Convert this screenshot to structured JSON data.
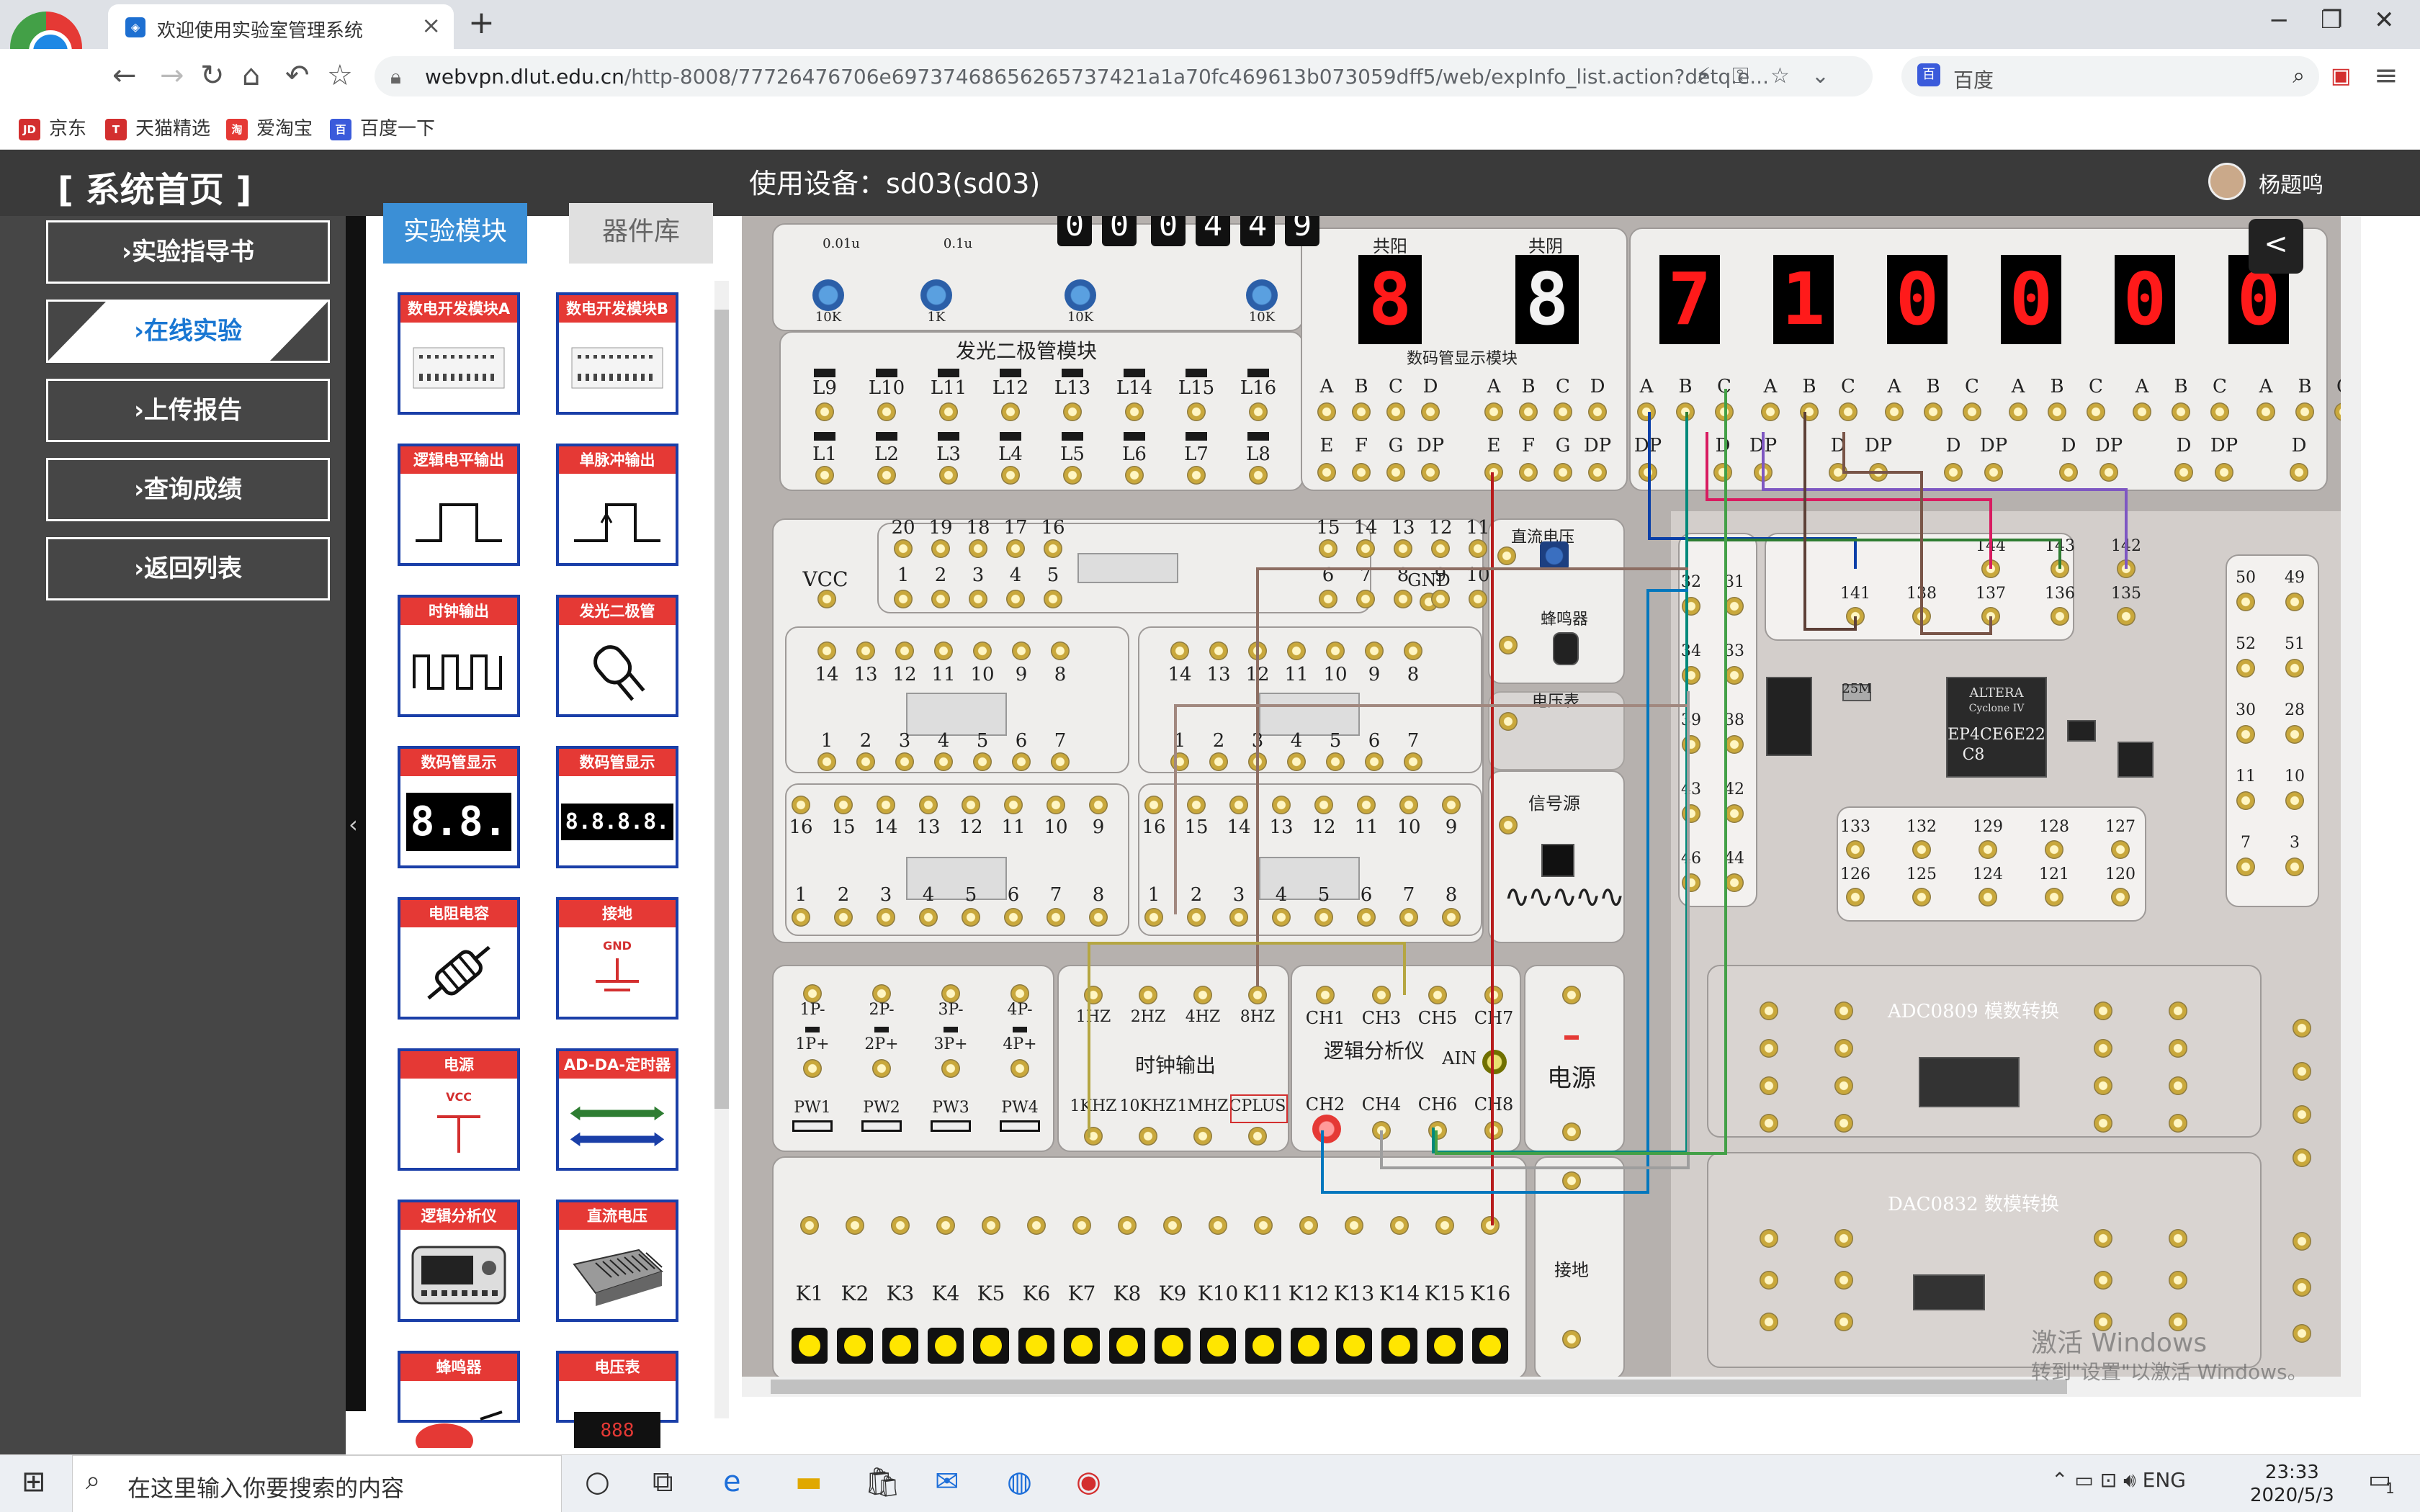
{
  "browser": {
    "tab_title": "欢迎使用实验室管理系统",
    "url_host": "webvpn.dlut.edu.cn",
    "url_path": "/http-8008/77726476706e69737468656265737421a1a70fc469613b073059dff5/web/expInfo_list.action?detq.e...",
    "search_engine": "百度",
    "bookmarks": [
      {
        "label": "京东",
        "icon": "jd-icon",
        "color": "#d32f2f",
        "badge": "JD"
      },
      {
        "label": "天猫精选",
        "icon": "tmall-icon",
        "color": "#d32f2f",
        "badge": "T"
      },
      {
        "label": "爱淘宝",
        "icon": "aitaobao-icon",
        "color": "#e53935",
        "badge": "淘"
      },
      {
        "label": "百度一下",
        "icon": "baidu-icon",
        "color": "#3b5bdb",
        "badge": "百"
      }
    ]
  },
  "header": {
    "home_label": "[ 系统首页 ]",
    "device_label": "使用设备：sd03(sd03)",
    "user_name": "杨题鸣"
  },
  "sidebar": {
    "items": [
      {
        "label": "›实验指导书",
        "active": false
      },
      {
        "label": "›在线实验",
        "active": true
      },
      {
        "label": "›上传报告",
        "active": false
      },
      {
        "label": "›查询成绩",
        "active": false
      },
      {
        "label": "›返回列表",
        "active": false
      }
    ]
  },
  "palette": {
    "tabs": [
      {
        "label": "实验模块",
        "active": true
      },
      {
        "label": "器件库",
        "active": false
      }
    ],
    "modules": [
      {
        "label": "数电开发模块A",
        "icon": "dev-board-icon"
      },
      {
        "label": "数电开发模块B",
        "icon": "dev-board-icon"
      },
      {
        "label": "逻辑电平输出",
        "icon": "logic-level-icon"
      },
      {
        "label": "单脉冲输出",
        "icon": "single-pulse-icon"
      },
      {
        "label": "时钟输出",
        "icon": "clock-wave-icon"
      },
      {
        "label": "发光二极管",
        "icon": "led-icon"
      },
      {
        "label": "数码管显示",
        "icon": "seven-seg-2-icon",
        "glyph": "8.8."
      },
      {
        "label": "数码管显示",
        "icon": "seven-seg-4-icon",
        "glyph": "8.8.8.8."
      },
      {
        "label": "电阻电容",
        "icon": "resistor-icon"
      },
      {
        "label": "接地",
        "icon": "ground-icon",
        "sub": "GND"
      },
      {
        "label": "电源",
        "icon": "power-icon",
        "sub": "VCC"
      },
      {
        "label": "AD-DA-定时器",
        "icon": "ad-da-icon"
      },
      {
        "label": "逻辑分析仪",
        "icon": "logic-analyzer-icon"
      },
      {
        "label": "直流电压",
        "icon": "dc-supply-icon"
      },
      {
        "label": "蜂鸣器",
        "icon": "buzzer-icon"
      },
      {
        "label": "电压表",
        "icon": "voltmeter-icon"
      }
    ]
  },
  "board": {
    "counter_digits": [
      "0",
      "0",
      "0",
      "4",
      "4",
      "9"
    ],
    "pot_labels": [
      "10K",
      "1K",
      "10K",
      "10K"
    ],
    "pot_top_labels": [
      "0.01u",
      "0.1u"
    ],
    "display_module": {
      "title": "数码管显示模块",
      "common_anode_label": "共阳",
      "common_cathode_label": "共阴",
      "single_digits": [
        "8",
        "8"
      ],
      "pins_top": [
        "A",
        "B",
        "C",
        "D",
        "A",
        "B",
        "C",
        "D"
      ],
      "pins_bottom": [
        "E",
        "F",
        "G",
        "DP",
        "E",
        "F",
        "G",
        "DP"
      ]
    },
    "six_digits": [
      "7",
      "1",
      "0",
      "0",
      "0",
      "0"
    ],
    "six_pins_top": [
      "A",
      "B",
      "C",
      "A",
      "B",
      "C",
      "A",
      "B",
      "C",
      "A",
      "B",
      "C",
      "A",
      "B",
      "C",
      "A",
      "B",
      "C"
    ],
    "six_pins_bottom": [
      "DP",
      "D",
      "DP",
      "D",
      "DP",
      "D",
      "DP",
      "D",
      "DP",
      "D",
      "DP",
      "D"
    ],
    "led_module": {
      "title": "发光二极管模块",
      "top_row": [
        "L9",
        "L10",
        "L11",
        "L12",
        "L13",
        "L14",
        "L15",
        "L16"
      ],
      "bottom_row": [
        "L1",
        "L2",
        "L3",
        "L4",
        "L5",
        "L6",
        "L7",
        "L8"
      ]
    },
    "ic_area": {
      "vcc": "VCC",
      "gnd": "GND",
      "dip20_top": [
        "20",
        "19",
        "18",
        "17",
        "16",
        "15",
        "14",
        "13",
        "12",
        "11"
      ],
      "dip20_bottom": [
        "1",
        "2",
        "3",
        "4",
        "5",
        "6",
        "7",
        "8",
        "9",
        "10"
      ],
      "dip14_top": [
        "14",
        "13",
        "12",
        "11",
        "10",
        "9",
        "8"
      ],
      "dip14_bottom": [
        "1",
        "2",
        "3",
        "4",
        "5",
        "6",
        "7"
      ],
      "dip16_top": [
        "16",
        "15",
        "14",
        "13",
        "12",
        "11",
        "10",
        "9"
      ],
      "dip16_bottom": [
        "1",
        "2",
        "3",
        "4",
        "5",
        "6",
        "7",
        "8"
      ]
    },
    "aux_modules": {
      "dc_voltage": "直流电压",
      "buzzer": "蜂鸣器",
      "voltmeter": "电压表",
      "signal_source": "信号源",
      "power": "电源",
      "ground": "接地"
    },
    "pulse": {
      "top": [
        "1P-",
        "2P-",
        "3P-",
        "4P-"
      ],
      "bottom": [
        "1P+",
        "2P+",
        "3P+",
        "4P+"
      ],
      "pw": [
        "PW1",
        "PW2",
        "PW3",
        "PW4"
      ]
    },
    "clock_output": {
      "title": "时钟输出",
      "top": [
        "1HZ",
        "2HZ",
        "4HZ",
        "8HZ"
      ],
      "bottom": [
        "1KHZ",
        "10KHZ",
        "1MHZ",
        "CPLUS"
      ]
    },
    "logic_analyzer": {
      "title": "逻辑分析仪",
      "top": [
        "CH1",
        "CH3",
        "CH5",
        "CH7"
      ],
      "bottom": [
        "CH2",
        "CH4",
        "CH6",
        "CH8"
      ],
      "ain": "AIN"
    },
    "keys": [
      "K1",
      "K2",
      "K3",
      "K4",
      "K5",
      "K6",
      "K7",
      "K8",
      "K9",
      "K10",
      "K11",
      "K12",
      "K13",
      "K14",
      "K15",
      "K16"
    ],
    "fpga": {
      "brand": "ALTERA",
      "family": "Cyclone IV",
      "part": "EP4CE6E22",
      "grade": "C8",
      "clock": "25M",
      "pins_top": [
        "144",
        "143",
        "142",
        "141",
        "138",
        "137",
        "136",
        "135"
      ],
      "pins_left": [
        "32",
        "31",
        "34",
        "33",
        "39",
        "38",
        "43",
        "42",
        "46",
        "44"
      ],
      "pins_bottom_a": [
        "133",
        "132",
        "129",
        "128",
        "127"
      ],
      "pins_bottom_b": [
        "126",
        "125",
        "124",
        "121",
        "120"
      ],
      "pins_right": [
        "50",
        "49",
        "52",
        "51",
        "30",
        "28",
        "11",
        "10",
        "7",
        "3"
      ]
    },
    "adc_label": "ADC0809 模数转换",
    "dac_label": "DAC0832 数模转换",
    "watermark_1": "激活 Windows",
    "watermark_2": "转到\"设置\"以激活 Windows。"
  },
  "taskbar": {
    "search_placeholder": "在这里输入你要搜索的内容",
    "time": "23:33",
    "date": "2020/5/3",
    "lang": "ENG",
    "notification_count": "1"
  }
}
